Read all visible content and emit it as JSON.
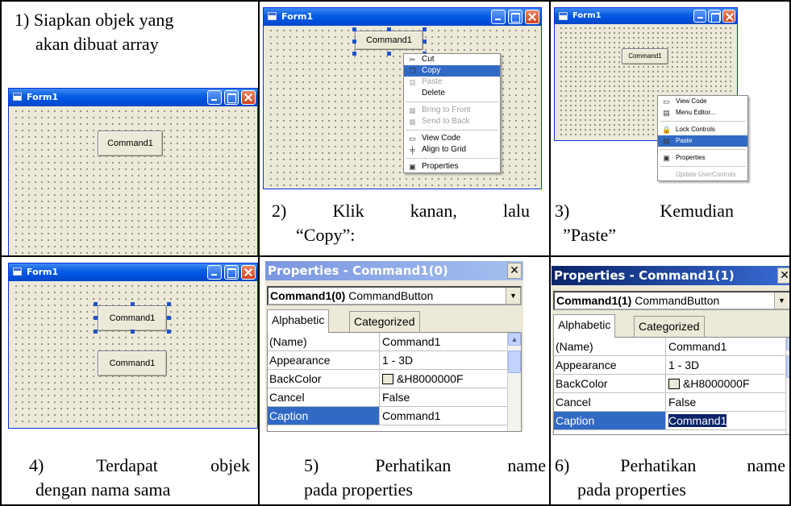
{
  "captions": {
    "c1_line1": "1) Siapkan objek yang",
    "c1_line2": "akan dibuat array",
    "c2_line1": "2) Klik kanan, lalu",
    "c2_line2": "“Copy”:",
    "c3_line1": "3) Kemudian",
    "c3_line2": "”Paste”",
    "c4_line1": "4) Terdapat objek",
    "c4_line2": "dengan nama sama",
    "c5_line1": "5) Perhatikan name",
    "c5_line2": "pada properties",
    "c6_line1": "6) Perhatikan name",
    "c6_line2": "pada properties"
  },
  "window": {
    "title": "Form1"
  },
  "button": {
    "label": "Command1"
  },
  "context_menu_copy": [
    {
      "label": "Cut",
      "icon": "scissors-icon",
      "glyph": "✂",
      "state": "normal"
    },
    {
      "label": "Copy",
      "icon": "copy-icon",
      "glyph": "❐",
      "state": "selected"
    },
    {
      "label": "Paste",
      "icon": "paste-icon",
      "glyph": "▤",
      "state": "disabled"
    },
    {
      "label": "Delete",
      "icon": "",
      "glyph": "",
      "state": "normal"
    },
    {
      "sep": true
    },
    {
      "label": "Bring to Front",
      "icon": "bring-to-front-icon",
      "glyph": "▦",
      "state": "disabled"
    },
    {
      "label": "Send to Back",
      "icon": "send-to-back-icon",
      "glyph": "▦",
      "state": "disabled"
    },
    {
      "sep": true
    },
    {
      "label": "View Code",
      "icon": "view-code-icon",
      "glyph": "▭",
      "state": "normal"
    },
    {
      "label": "Align to Grid",
      "icon": "align-grid-icon",
      "glyph": "╪",
      "state": "normal"
    },
    {
      "sep": true
    },
    {
      "label": "Properties",
      "icon": "properties-icon",
      "glyph": "▣",
      "state": "normal"
    }
  ],
  "context_menu_paste": [
    {
      "label": "View Code",
      "icon": "view-code-icon",
      "glyph": "▭",
      "state": "normal"
    },
    {
      "label": "Menu Editor...",
      "icon": "menu-editor-icon",
      "glyph": "▤",
      "state": "normal"
    },
    {
      "sep": true
    },
    {
      "label": "Lock Controls",
      "icon": "lock-icon",
      "glyph": "🔒",
      "state": "normal"
    },
    {
      "label": "Paste",
      "icon": "paste-icon",
      "glyph": "▤",
      "state": "selected"
    },
    {
      "sep": true
    },
    {
      "label": "Properties",
      "icon": "properties-icon",
      "glyph": "▣",
      "state": "normal"
    },
    {
      "sep": true
    },
    {
      "label": "Update UserControls",
      "icon": "",
      "glyph": "",
      "state": "disabled"
    }
  ],
  "props0": {
    "title": "Properties - Command1(0)",
    "object_bold": "Command1(0)",
    "object_type": " CommandButton",
    "tab_alpha": "Alphabetic",
    "tab_cat": "Categorized",
    "rows": [
      {
        "name": "(Name)",
        "value": "Command1"
      },
      {
        "name": "Appearance",
        "value": "1 - 3D"
      },
      {
        "name": "BackColor",
        "value": "&H8000000F"
      },
      {
        "name": "Cancel",
        "value": "False"
      },
      {
        "name": "Caption",
        "value": "Command1"
      }
    ]
  },
  "props1": {
    "title": "Properties - Command1(1)",
    "object_bold": "Command1(1)",
    "object_type": " CommandButton",
    "tab_alpha": "Alphabetic",
    "tab_cat": "Categorized",
    "rows": [
      {
        "name": "(Name)",
        "value": "Command1"
      },
      {
        "name": "Appearance",
        "value": "1 - 3D"
      },
      {
        "name": "BackColor",
        "value": "&H8000000F"
      },
      {
        "name": "Cancel",
        "value": "False"
      },
      {
        "name": "Caption",
        "value": "Command1"
      }
    ]
  },
  "colors": {
    "menu_highlight": "#316ac5",
    "titlebar": "#0054e3",
    "form_bg": "#ece9d8"
  }
}
